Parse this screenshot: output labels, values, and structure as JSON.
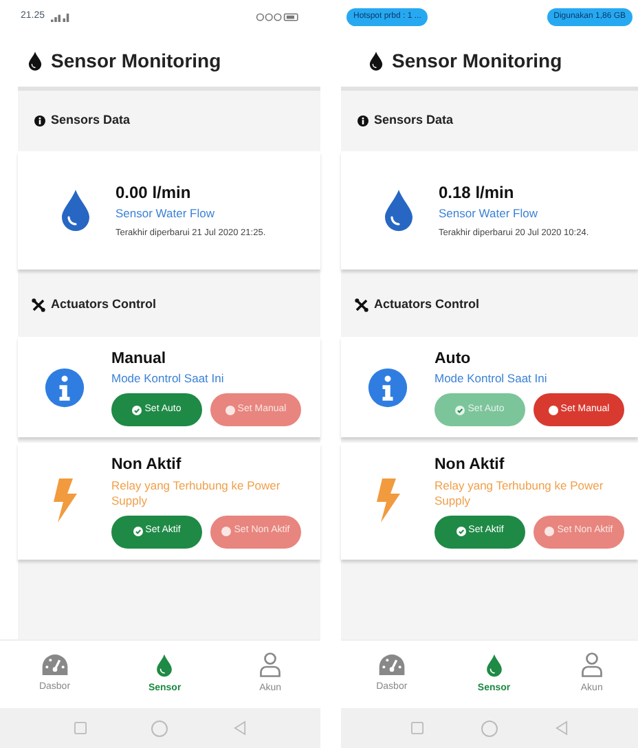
{
  "phones": [
    {
      "status_bar": {
        "kind": "clock",
        "time": "21.25"
      },
      "title": "Sensor Monitoring",
      "sensors": {
        "heading": "Sensors Data",
        "value": "0.00 l/min",
        "label": "Sensor Water Flow",
        "updated": "Terakhir diperbarui 21 Jul 2020 21:25."
      },
      "actuators": {
        "heading": "Actuators Control",
        "cards": [
          {
            "kind": "mode",
            "status": "Manual",
            "label": "Mode Kontrol Saat Ini",
            "buttons": [
              {
                "kind": "check",
                "label": "Set Auto",
                "disabled": false
              },
              {
                "kind": "dot",
                "label": "Set Manual",
                "disabled": true
              }
            ]
          },
          {
            "kind": "relay",
            "status": "Non Aktif",
            "label": "Relay yang Terhubung ke Power Supply",
            "buttons": [
              {
                "kind": "check",
                "label": "Set Aktif",
                "disabled": false
              },
              {
                "kind": "dot",
                "label": "Set Non Aktif",
                "disabled": true
              }
            ]
          }
        ]
      },
      "nav": [
        {
          "kind": "gauge",
          "label": "Dasbor",
          "selected": false
        },
        {
          "kind": "drop",
          "label": "Sensor",
          "selected": true
        },
        {
          "kind": "person",
          "label": "Akun",
          "selected": false
        }
      ]
    },
    {
      "status_bar": {
        "kind": "pills",
        "pills": [
          "Hotspot prbd : 1 ...",
          "Digunakan 1,86 GB"
        ]
      },
      "title": "Sensor Monitoring",
      "sensors": {
        "heading": "Sensors Data",
        "value": "0.18 l/min",
        "label": "Sensor Water Flow",
        "updated": "Terakhir diperbarui 20 Jul 2020 10:24."
      },
      "actuators": {
        "heading": "Actuators Control",
        "cards": [
          {
            "kind": "mode",
            "status": "Auto",
            "label": "Mode Kontrol Saat Ini",
            "buttons": [
              {
                "kind": "check",
                "label": "Set Auto",
                "disabled": true
              },
              {
                "kind": "dot",
                "label": "Set Manual",
                "disabled": false
              }
            ]
          },
          {
            "kind": "relay",
            "status": "Non Aktif",
            "label": "Relay yang Terhubung ke Power Supply",
            "buttons": [
              {
                "kind": "check",
                "label": "Set Aktif",
                "disabled": false
              },
              {
                "kind": "dot",
                "label": "Set Non Aktif",
                "disabled": true
              }
            ]
          }
        ]
      },
      "nav": [
        {
          "kind": "gauge",
          "label": "Dasbor",
          "selected": false
        },
        {
          "kind": "drop",
          "label": "Sensor",
          "selected": true
        },
        {
          "kind": "person",
          "label": "Akun",
          "selected": false
        }
      ]
    }
  ]
}
